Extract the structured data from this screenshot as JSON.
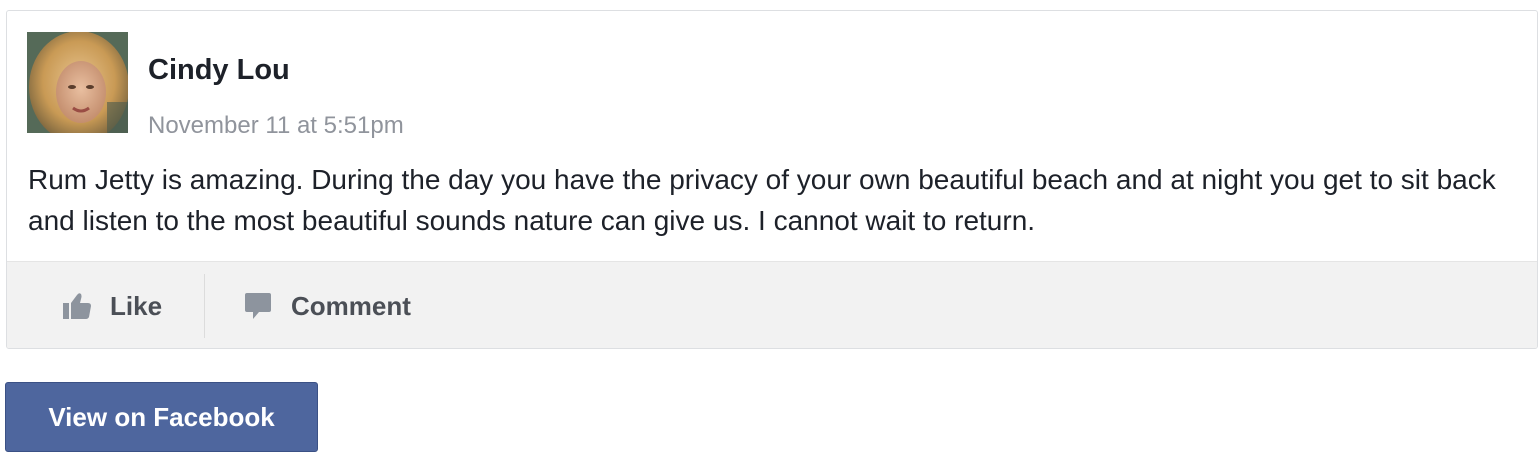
{
  "post": {
    "author": {
      "name": "Cindy Lou",
      "avatar_icon": "profile-photo"
    },
    "timestamp": "November 11 at 5:51pm",
    "text": "Rum Jetty is amazing. During the day you have the privacy of your own beautiful beach and at night you get to sit back and listen to the most beautiful sounds nature can give us. I cannot wait to return."
  },
  "actions": {
    "like": {
      "label": "Like",
      "icon": "thumbs-up-icon"
    },
    "comment": {
      "label": "Comment",
      "icon": "speech-bubble-icon"
    }
  },
  "footer": {
    "view_button_label": "View on Facebook"
  },
  "colors": {
    "name_text": "#1d2129",
    "meta_text": "#90949c",
    "action_text": "#4b4f56",
    "action_bar_bg": "#f2f2f2",
    "button_bg": "#4e669e"
  }
}
